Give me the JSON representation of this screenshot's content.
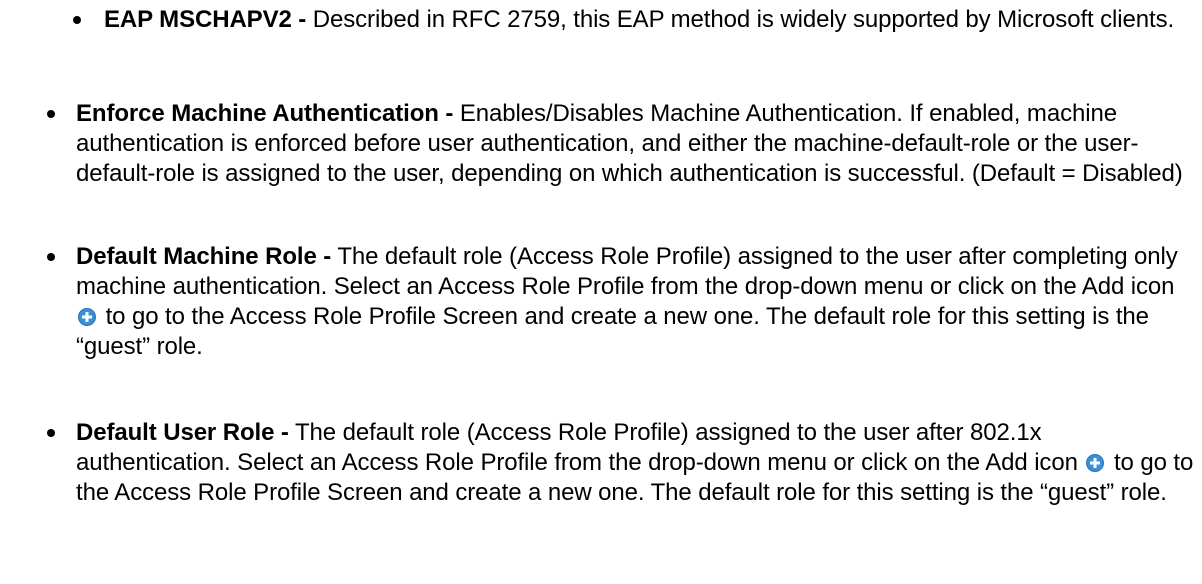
{
  "items": [
    {
      "term": "EAP MSCHAPV2 -",
      "text": "Described in RFC 2759, this EAP method is widely supported by Microsoft clients."
    },
    {
      "term": "Enforce Machine Authentication -",
      "text": "Enables/Disables Machine Authentication. If enabled, machine authentication is enforced before user authentication, and either the machine-default-role or the user-default-role is assigned to the user, depending on which authentication is successful. (Default = Disabled)"
    },
    {
      "term": "Default Machine Role -",
      "text_before_icon": "The default role (Access Role Profile) assigned to the user after completing only machine authentication. Select an Access Role Profile from the drop-down menu or click on the Add icon",
      "text_after_icon": "to go to the Access Role Profile Screen and create a new one. The default role for this setting is the “guest” role."
    },
    {
      "term": "Default User Role -",
      "text_before_icon": "The default role (Access Role Profile) assigned to the user after 802.1x authentication. Select an Access Role Profile from the drop-down menu or click on the Add icon",
      "text_after_icon": "to go to the Access Role Profile Screen and create a new one. The default role for this setting is the “guest” role."
    }
  ],
  "icons": {
    "add_icon": "plus-circle",
    "add_icon_color": "#3a8fd8"
  }
}
